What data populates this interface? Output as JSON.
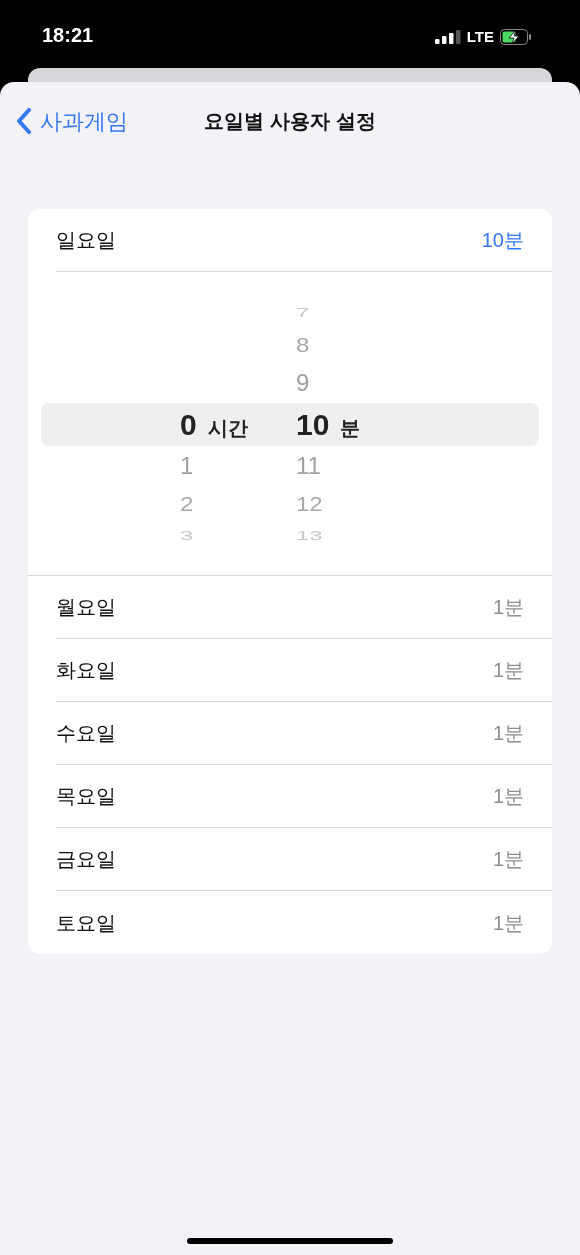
{
  "status_bar": {
    "time": "18:21",
    "network": "LTE"
  },
  "nav": {
    "back_label": "사과게임",
    "title": "요일별 사용자 설정"
  },
  "days": [
    {
      "name": "일요일",
      "value": "10분",
      "expanded": true
    },
    {
      "name": "월요일",
      "value": "1분",
      "expanded": false
    },
    {
      "name": "화요일",
      "value": "1분",
      "expanded": false
    },
    {
      "name": "수요일",
      "value": "1분",
      "expanded": false
    },
    {
      "name": "목요일",
      "value": "1분",
      "expanded": false
    },
    {
      "name": "금요일",
      "value": "1분",
      "expanded": false
    },
    {
      "name": "토요일",
      "value": "1분",
      "expanded": false
    }
  ],
  "picker": {
    "hours": {
      "unit": "시간",
      "items": [
        {
          "label": "0",
          "selected": true
        },
        {
          "label": "1",
          "selected": false
        },
        {
          "label": "2",
          "selected": false
        },
        {
          "label": "3",
          "selected": false
        }
      ]
    },
    "minutes": {
      "unit": "분",
      "items": [
        {
          "label": "7",
          "selected": false
        },
        {
          "label": "8",
          "selected": false
        },
        {
          "label": "9",
          "selected": false
        },
        {
          "label": "10",
          "selected": true
        },
        {
          "label": "11",
          "selected": false
        },
        {
          "label": "12",
          "selected": false
        },
        {
          "label": "13",
          "selected": false
        }
      ]
    }
  }
}
